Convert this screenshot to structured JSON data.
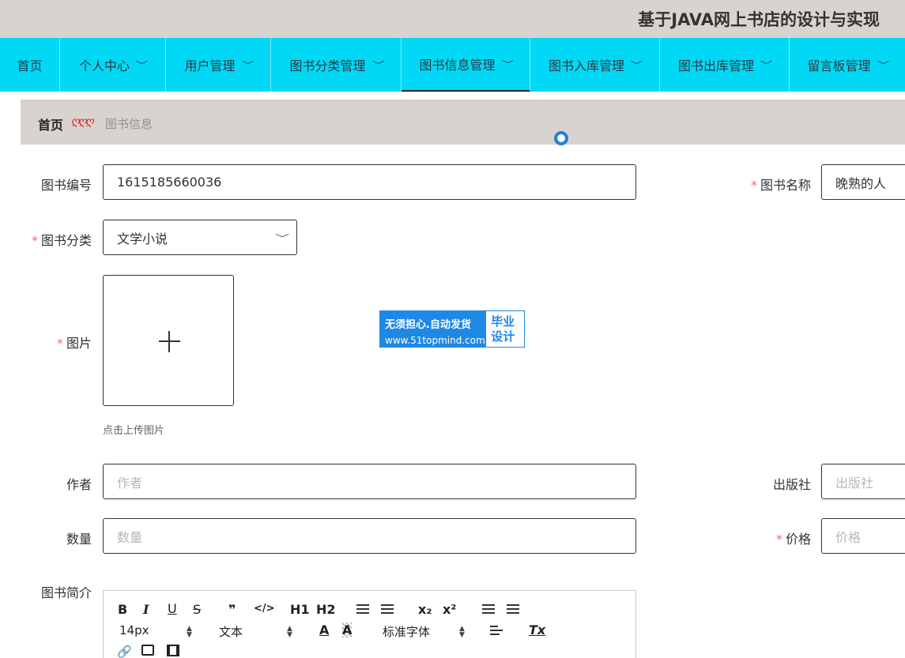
{
  "header": {
    "title": "基于JAVA网上书店的设计与实现"
  },
  "nav": {
    "items": [
      {
        "label": "首页",
        "has_menu": false
      },
      {
        "label": "个人中心",
        "has_menu": true
      },
      {
        "label": "用户管理",
        "has_menu": true
      },
      {
        "label": "图书分类管理",
        "has_menu": true
      },
      {
        "label": "图书信息管理",
        "has_menu": true,
        "active": true
      },
      {
        "label": "图书入库管理",
        "has_menu": true
      },
      {
        "label": "图书出库管理",
        "has_menu": true
      },
      {
        "label": "留言板管理",
        "has_menu": true
      }
    ],
    "chevron": "﹀"
  },
  "breadcrumb": {
    "home": "首页",
    "separator": "ღღღ",
    "current": "图书信息"
  },
  "form": {
    "book_no": {
      "label": "图书编号",
      "value": "1615185660036"
    },
    "book_name": {
      "label": "图书名称",
      "value": "晚熟的人"
    },
    "category": {
      "label": "图书分类",
      "value": "文学小说"
    },
    "image": {
      "label": "图片",
      "tip": "点击上传图片"
    },
    "author": {
      "label": "作者",
      "placeholder": "作者"
    },
    "publisher": {
      "label": "出版社",
      "placeholder": "出版社"
    },
    "quantity": {
      "label": "数量",
      "placeholder": "数量"
    },
    "price": {
      "label": "价格",
      "placeholder": "价格"
    },
    "intro": {
      "label": "图书简介"
    },
    "required_mark": "*"
  },
  "editor": {
    "row1": [
      "B",
      "I",
      "U",
      "S",
      "❞",
      "</>",
      "H1",
      "H2",
      "x₂",
      "x²"
    ],
    "font_size": "14px",
    "paragraph": "文本",
    "font_family": "标准字体",
    "clear_format": "Tx"
  },
  "watermark": {
    "line1": "无须担心.自动发货",
    "line2": "www.51topmind.com",
    "side1": "毕业",
    "side2": "设计"
  }
}
